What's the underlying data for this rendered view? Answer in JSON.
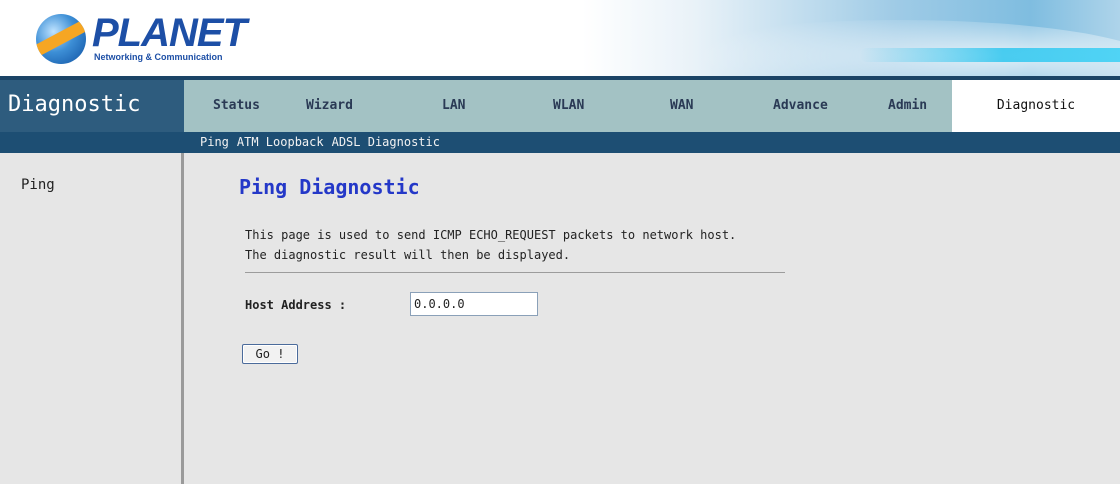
{
  "header": {
    "brand": "PLANET",
    "tagline": "Networking & Communication"
  },
  "nav": {
    "section_title": "Diagnostic",
    "items": [
      {
        "label": "Status"
      },
      {
        "label": "Wizard"
      },
      {
        "label": "LAN"
      },
      {
        "label": "WLAN"
      },
      {
        "label": "WAN"
      },
      {
        "label": "Advance"
      },
      {
        "label": "Admin"
      },
      {
        "label": "Diagnostic",
        "active": true
      }
    ]
  },
  "subnav": {
    "items": [
      {
        "label": "Ping"
      },
      {
        "label": "ATM Loopback"
      },
      {
        "label": "ADSL Diagnostic"
      }
    ]
  },
  "sidebar": {
    "items": [
      {
        "label": "Ping"
      }
    ]
  },
  "main": {
    "title": "Ping Diagnostic",
    "description_line1": "This page is used to send ICMP ECHO_REQUEST packets to network host.",
    "description_line2": "The diagnostic result will then be displayed.",
    "host_label": "Host Address :",
    "host_value": "0.0.0.0",
    "go_label": "Go !"
  },
  "colors": {
    "nav_bar": "#a3c2c4",
    "nav_title_bg": "#2e5c7e",
    "subnav_bg": "#1d4e73",
    "title_blue": "#2438c8",
    "page_bg": "#e6e6e6"
  }
}
